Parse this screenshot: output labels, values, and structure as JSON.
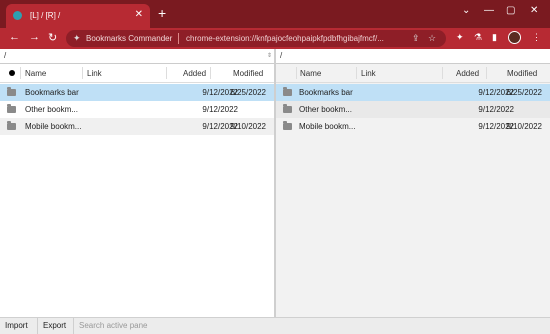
{
  "browser": {
    "tab_title": "[L] / [R] /",
    "close_glyph": "✕",
    "new_tab_glyph": "+",
    "window_controls": {
      "menu": "⌄",
      "minimize": "—",
      "maximize": "▢",
      "close": "✕"
    },
    "nav": {
      "back": "←",
      "forward": "→",
      "reload": "↻"
    },
    "omnibox": {
      "site_name": "Bookmarks Commander",
      "url": "chrome-extension://knfpajocfeohpaipkfpdbfhgibajfmcf/...",
      "share_glyph": "⇪",
      "star_glyph": "☆"
    },
    "toolbar_icons": {
      "extensions": "✦",
      "lab": "⚗",
      "sidepanel": "▮",
      "menu": "⋮"
    },
    "colors": {
      "frame": "#7a1a20",
      "toolbar": "#b72a33",
      "selection": "#bfe0f6"
    }
  },
  "left_pane": {
    "path": "/",
    "columns": {
      "name": "Name",
      "link": "Link",
      "added": "Added",
      "modified": "Modified"
    },
    "rows": [
      {
        "name": "Bookmarks bar",
        "added": "9/12/2022",
        "modified": "6/25/2022"
      },
      {
        "name": "Other bookm...",
        "added": "9/12/2022",
        "modified": ""
      },
      {
        "name": "Mobile bookm...",
        "added": "9/12/2022",
        "modified": "9/10/2022"
      }
    ]
  },
  "right_pane": {
    "path": "/",
    "columns": {
      "name": "Name",
      "link": "Link",
      "added": "Added",
      "modified": "Modified"
    },
    "rows": [
      {
        "name": "Bookmarks bar",
        "added": "9/12/2022",
        "modified": "6/25/2022"
      },
      {
        "name": "Other bookm...",
        "added": "9/12/2022",
        "modified": ""
      },
      {
        "name": "Mobile bookm...",
        "added": "9/12/2022",
        "modified": "9/10/2022"
      }
    ]
  },
  "bottom_bar": {
    "import_label": "Import",
    "export_label": "Export",
    "search_placeholder": "Search active pane"
  }
}
